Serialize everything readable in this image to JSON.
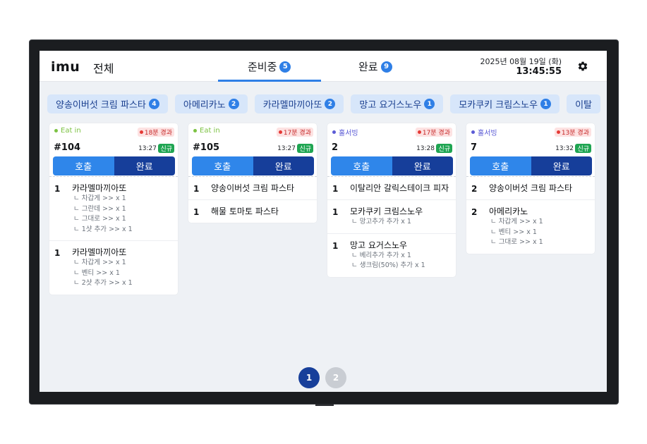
{
  "header": {
    "logo": "imu",
    "scope": "전체",
    "tabs": [
      {
        "label": "준비중",
        "count": "5"
      },
      {
        "label": "완료",
        "count": "9"
      }
    ],
    "date": "2025년 08월 19일 (화)",
    "time": "13:45:55",
    "settings_icon": "gear-icon"
  },
  "chips": [
    {
      "label": "양송이버섯 크림 파스타",
      "count": "4"
    },
    {
      "label": "아메리카노",
      "count": "2"
    },
    {
      "label": "카라멜마끼아또",
      "count": "2"
    },
    {
      "label": "망고 요거스노우",
      "count": "1"
    },
    {
      "label": "모카쿠키 크림스노우",
      "count": "1"
    },
    {
      "label": "이탈"
    }
  ],
  "orders": [
    {
      "type": "Eat in",
      "type_color": "#7cc242",
      "elapsed": "18분 경과",
      "order_no": "#104",
      "time": "13:27",
      "badge": "신규",
      "call_label": "호출",
      "done_label": "완료",
      "items": [
        {
          "qty": "1",
          "name": "카라멜마끼아또",
          "options": [
            "ㄴ 차갑게 >> x 1",
            "ㄴ 그란데 >> x 1",
            "ㄴ 그대로 >> x 1",
            "ㄴ 1샷 추가 >> x 1"
          ]
        },
        {
          "qty": "1",
          "name": "카라멜마끼아또",
          "options": [
            "ㄴ 차갑게 >> x 1",
            "ㄴ 벤티 >> x 1",
            "ㄴ 2샷 추가 >> x 1"
          ]
        }
      ]
    },
    {
      "type": "Eat in",
      "type_color": "#7cc242",
      "elapsed": "17분 경과",
      "order_no": "#105",
      "time": "13:27",
      "badge": "신규",
      "call_label": "호출",
      "done_label": "완료",
      "items": [
        {
          "qty": "1",
          "name": "양송이버섯 크림 파스타",
          "options": []
        },
        {
          "qty": "1",
          "name": "해물 토마토 파스타",
          "options": []
        }
      ]
    },
    {
      "type": "홀서빙",
      "type_color": "#5b5bd6",
      "elapsed": "17분 경과",
      "order_no": "2",
      "time": "13:28",
      "badge": "신규",
      "call_label": "호출",
      "done_label": "완료",
      "items": [
        {
          "qty": "1",
          "name": "이탈리안 갈릭스테이크 피자",
          "options": []
        },
        {
          "qty": "1",
          "name": "모카쿠키 크림스노우",
          "options": [
            "ㄴ 망고추가 추가 x 1"
          ]
        },
        {
          "qty": "1",
          "name": "망고 요거스노우",
          "options": [
            "ㄴ 베리추가 추가 x 1",
            "ㄴ 생크림(50%) 추가 x 1"
          ]
        }
      ]
    },
    {
      "type": "홀서빙",
      "type_color": "#5b5bd6",
      "elapsed": "13분 경과",
      "order_no": "7",
      "time": "13:32",
      "badge": "신규",
      "call_label": "호출",
      "done_label": "완료",
      "items": [
        {
          "qty": "2",
          "name": "양송이버섯 크림 파스타",
          "options": []
        },
        {
          "qty": "2",
          "name": "아메리카노",
          "options": [
            "ㄴ 차갑게 >> x 1",
            "ㄴ 벤티 >> x 1",
            "ㄴ 그대로 >> x 1"
          ]
        }
      ]
    }
  ],
  "pager": {
    "pages": [
      "1",
      "2"
    ],
    "active": "1",
    "active_color": "#173f9a",
    "inactive_color": "#c9cdd3"
  }
}
